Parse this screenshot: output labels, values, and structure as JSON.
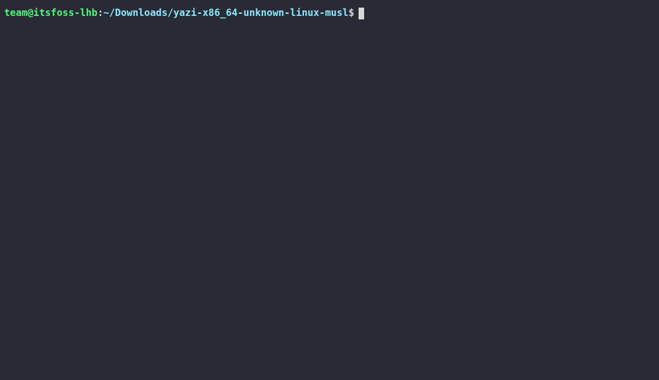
{
  "prompt": {
    "user_host": "team@itsfoss-lhb",
    "separator": ":",
    "path": "~/Downloads/yazi-x86_64-unknown-linux-musl",
    "symbol": "$"
  }
}
